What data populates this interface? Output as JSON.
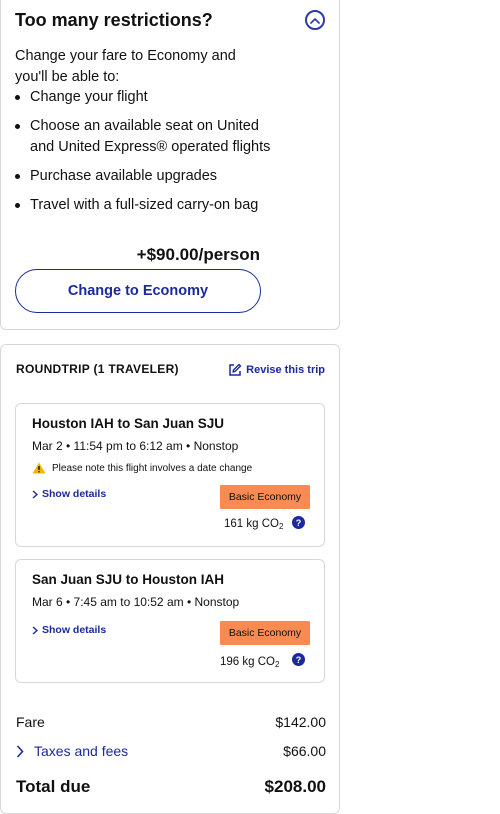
{
  "upsell": {
    "title": "Too many restrictions?",
    "intro": "Change your fare to Economy and you'll be able to:",
    "benefits": [
      "Change your flight",
      "Choose an available seat on United and United Express® operated flights",
      "Purchase available upgrades",
      "Travel with a full-sized carry-on bag"
    ],
    "price": "+$90.00/person",
    "cta_label": "Change to Economy"
  },
  "trip": {
    "heading": "ROUNDTRIP (1 TRAVELER)",
    "revise_label": "Revise this trip",
    "flights": [
      {
        "route": "Houston IAH to San Juan SJU",
        "times": "Mar 2 • 11:54 pm to 6:12 am • Nonstop",
        "warning": "Please note this flight involves a date change",
        "details_label": "Show details",
        "fare_class": "Basic Economy",
        "co2_value": "161 kg CO",
        "co2_sub": "2"
      },
      {
        "route": "San Juan SJU to Houston IAH",
        "times": "Mar 6 • 7:45 am to 10:52 am • Nonstop",
        "details_label": "Show details",
        "fare_class": "Basic Economy",
        "co2_value": "196 kg CO",
        "co2_sub": "2"
      }
    ]
  },
  "pricing": {
    "fare_label": "Fare",
    "fare_value": "$142.00",
    "taxes_label": "Taxes and fees",
    "taxes_value": "$66.00",
    "total_label": "Total due",
    "total_value": "$208.00"
  },
  "colors": {
    "brand_blue": "#1a2a9c",
    "badge_orange": "#f98a52",
    "warning_yellow": "#f2b705"
  },
  "icons": {
    "collapse": "chevron-up-icon",
    "revise": "edit-icon",
    "warning": "warning-icon",
    "details": "chevron-right-icon",
    "help": "help-icon",
    "taxes": "chevron-right-icon"
  }
}
